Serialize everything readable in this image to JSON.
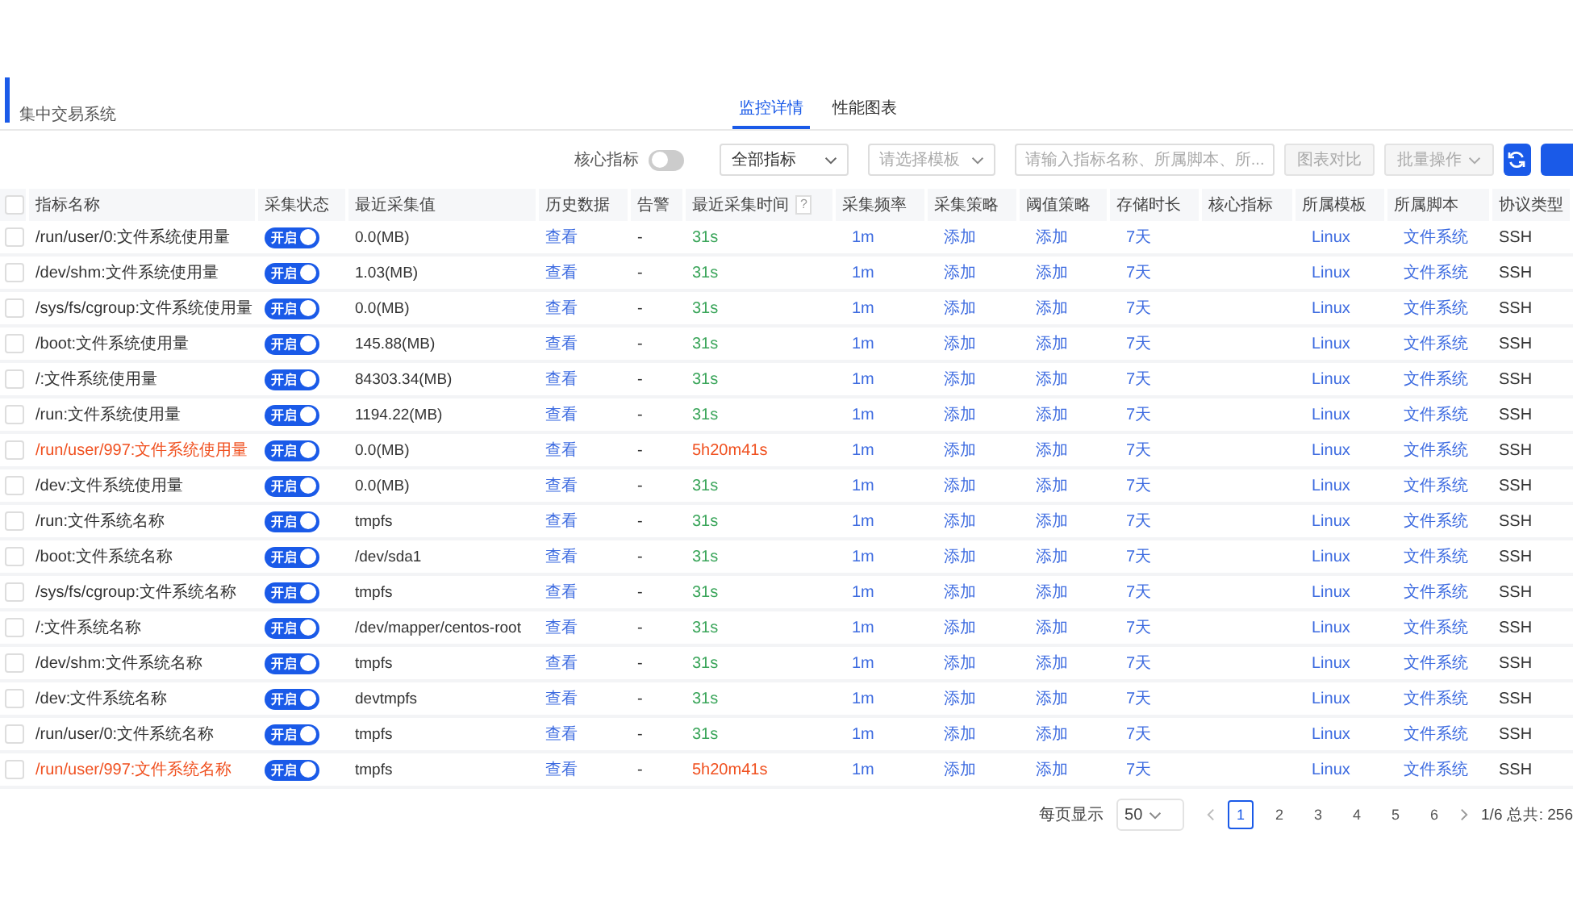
{
  "header": {
    "subtitle": "集中交易系统"
  },
  "tabs": [
    {
      "label": "监控详情",
      "selected": true
    },
    {
      "label": "性能图表",
      "selected": false
    }
  ],
  "toolbar": {
    "core_label": "核心指标",
    "core_on": false,
    "metric_select": "全部指标",
    "template_placeholder": "请选择模板",
    "search_placeholder": "请输入指标名称、所属脚本、所...",
    "compare_button": "图表对比",
    "batch_button": "批量操作"
  },
  "table": {
    "all_checked": false,
    "help_mark": "?",
    "columns": [
      "指标名称",
      "采集状态",
      "最近采集值",
      "历史数据",
      "告警",
      "最近采集时间",
      "采集频率",
      "采集策略",
      "阈值策略",
      "存储时长",
      "核心指标",
      "所属模板",
      "所属脚本",
      "协议类型"
    ],
    "rows": [
      {
        "checked": false,
        "name": "/run/user/0:文件系统使用量",
        "alert": false,
        "status": "开启",
        "on": true,
        "value": "0.0(MB)",
        "history": "查看",
        "alarm": "-",
        "time": "31s",
        "freq": "1m",
        "collect": "添加",
        "threshold": "添加",
        "storage": "7天",
        "template": "Linux",
        "script": "文件系统",
        "protocol": "SSH"
      },
      {
        "checked": false,
        "name": "/dev/shm:文件系统使用量",
        "alert": false,
        "status": "开启",
        "on": true,
        "value": "1.03(MB)",
        "history": "查看",
        "alarm": "-",
        "time": "31s",
        "freq": "1m",
        "collect": "添加",
        "threshold": "添加",
        "storage": "7天",
        "template": "Linux",
        "script": "文件系统",
        "protocol": "SSH"
      },
      {
        "checked": false,
        "name": "/sys/fs/cgroup:文件系统使用量",
        "alert": false,
        "status": "开启",
        "on": true,
        "value": "0.0(MB)",
        "history": "查看",
        "alarm": "-",
        "time": "31s",
        "freq": "1m",
        "collect": "添加",
        "threshold": "添加",
        "storage": "7天",
        "template": "Linux",
        "script": "文件系统",
        "protocol": "SSH"
      },
      {
        "checked": false,
        "name": "/boot:文件系统使用量",
        "alert": false,
        "status": "开启",
        "on": true,
        "value": "145.88(MB)",
        "history": "查看",
        "alarm": "-",
        "time": "31s",
        "freq": "1m",
        "collect": "添加",
        "threshold": "添加",
        "storage": "7天",
        "template": "Linux",
        "script": "文件系统",
        "protocol": "SSH"
      },
      {
        "checked": false,
        "name": "/:文件系统使用量",
        "alert": false,
        "status": "开启",
        "on": true,
        "value": "84303.34(MB)",
        "history": "查看",
        "alarm": "-",
        "time": "31s",
        "freq": "1m",
        "collect": "添加",
        "threshold": "添加",
        "storage": "7天",
        "template": "Linux",
        "script": "文件系统",
        "protocol": "SSH"
      },
      {
        "checked": false,
        "name": "/run:文件系统使用量",
        "alert": false,
        "status": "开启",
        "on": true,
        "value": "1194.22(MB)",
        "history": "查看",
        "alarm": "-",
        "time": "31s",
        "freq": "1m",
        "collect": "添加",
        "threshold": "添加",
        "storage": "7天",
        "template": "Linux",
        "script": "文件系统",
        "protocol": "SSH"
      },
      {
        "checked": false,
        "name": "/run/user/997:文件系统使用量",
        "alert": true,
        "status": "开启",
        "on": true,
        "value": "0.0(MB)",
        "history": "查看",
        "alarm": "-",
        "time": "5h20m41s",
        "freq": "1m",
        "collect": "添加",
        "threshold": "添加",
        "storage": "7天",
        "template": "Linux",
        "script": "文件系统",
        "protocol": "SSH"
      },
      {
        "checked": false,
        "name": "/dev:文件系统使用量",
        "alert": false,
        "status": "开启",
        "on": true,
        "value": "0.0(MB)",
        "history": "查看",
        "alarm": "-",
        "time": "31s",
        "freq": "1m",
        "collect": "添加",
        "threshold": "添加",
        "storage": "7天",
        "template": "Linux",
        "script": "文件系统",
        "protocol": "SSH"
      },
      {
        "checked": false,
        "name": "/run:文件系统名称",
        "alert": false,
        "status": "开启",
        "on": true,
        "value": "tmpfs",
        "history": "查看",
        "alarm": "-",
        "time": "31s",
        "freq": "1m",
        "collect": "添加",
        "threshold": "添加",
        "storage": "7天",
        "template": "Linux",
        "script": "文件系统",
        "protocol": "SSH"
      },
      {
        "checked": false,
        "name": "/boot:文件系统名称",
        "alert": false,
        "status": "开启",
        "on": true,
        "value": "/dev/sda1",
        "history": "查看",
        "alarm": "-",
        "time": "31s",
        "freq": "1m",
        "collect": "添加",
        "threshold": "添加",
        "storage": "7天",
        "template": "Linux",
        "script": "文件系统",
        "protocol": "SSH"
      },
      {
        "checked": false,
        "name": "/sys/fs/cgroup:文件系统名称",
        "alert": false,
        "status": "开启",
        "on": true,
        "value": "tmpfs",
        "history": "查看",
        "alarm": "-",
        "time": "31s",
        "freq": "1m",
        "collect": "添加",
        "threshold": "添加",
        "storage": "7天",
        "template": "Linux",
        "script": "文件系统",
        "protocol": "SSH"
      },
      {
        "checked": false,
        "name": "/:文件系统名称",
        "alert": false,
        "status": "开启",
        "on": true,
        "value": "/dev/mapper/centos-root",
        "history": "查看",
        "alarm": "-",
        "time": "31s",
        "freq": "1m",
        "collect": "添加",
        "threshold": "添加",
        "storage": "7天",
        "template": "Linux",
        "script": "文件系统",
        "protocol": "SSH"
      },
      {
        "checked": false,
        "name": "/dev/shm:文件系统名称",
        "alert": false,
        "status": "开启",
        "on": true,
        "value": "tmpfs",
        "history": "查看",
        "alarm": "-",
        "time": "31s",
        "freq": "1m",
        "collect": "添加",
        "threshold": "添加",
        "storage": "7天",
        "template": "Linux",
        "script": "文件系统",
        "protocol": "SSH"
      },
      {
        "checked": false,
        "name": "/dev:文件系统名称",
        "alert": false,
        "status": "开启",
        "on": true,
        "value": "devtmpfs",
        "history": "查看",
        "alarm": "-",
        "time": "31s",
        "freq": "1m",
        "collect": "添加",
        "threshold": "添加",
        "storage": "7天",
        "template": "Linux",
        "script": "文件系统",
        "protocol": "SSH"
      },
      {
        "checked": false,
        "name": "/run/user/0:文件系统名称",
        "alert": false,
        "status": "开启",
        "on": true,
        "value": "tmpfs",
        "history": "查看",
        "alarm": "-",
        "time": "31s",
        "freq": "1m",
        "collect": "添加",
        "threshold": "添加",
        "storage": "7天",
        "template": "Linux",
        "script": "文件系统",
        "protocol": "SSH"
      },
      {
        "checked": false,
        "name": "/run/user/997:文件系统名称",
        "alert": true,
        "status": "开启",
        "on": true,
        "value": "tmpfs",
        "history": "查看",
        "alarm": "-",
        "time": "5h20m41s",
        "freq": "1m",
        "collect": "添加",
        "threshold": "添加",
        "storage": "7天",
        "template": "Linux",
        "script": "文件系统",
        "protocol": "SSH"
      }
    ]
  },
  "pagination": {
    "per_page_label": "每页显示",
    "per_page": "50",
    "pages": [
      {
        "label": "1",
        "selected": true
      },
      {
        "label": "2",
        "selected": false
      },
      {
        "label": "3",
        "selected": false
      },
      {
        "label": "4",
        "selected": false
      },
      {
        "label": "5",
        "selected": false
      },
      {
        "label": "6",
        "selected": false
      }
    ],
    "summary": "1/6 总共: 256"
  }
}
